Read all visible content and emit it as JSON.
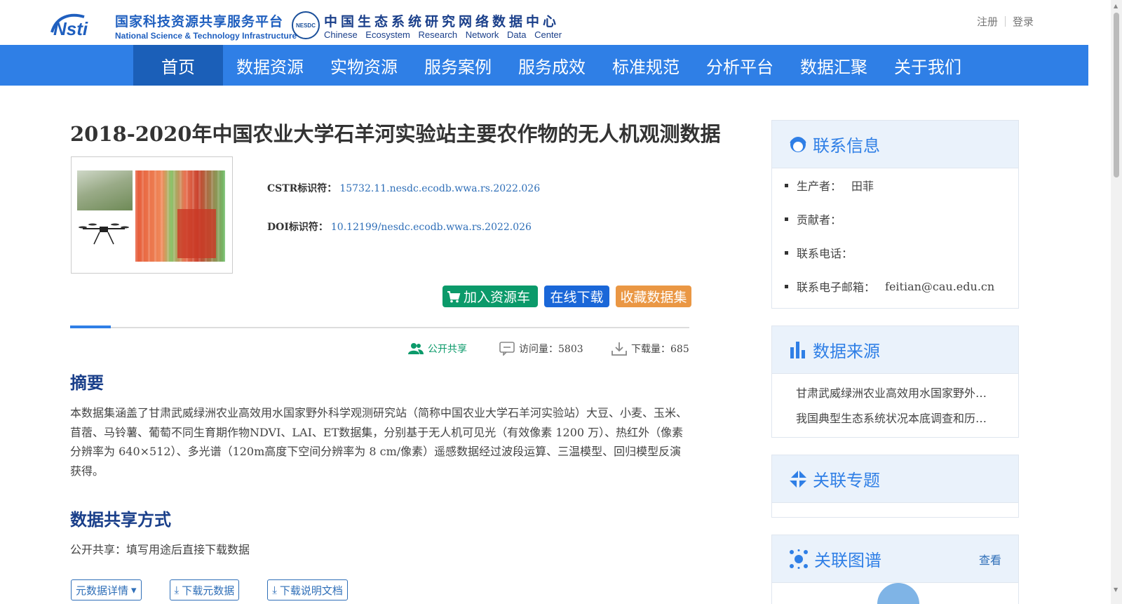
{
  "header": {
    "platform_logo_text": "Nsti",
    "platform_cn": "国家科技资源共享服务平台",
    "platform_en": "National Science & Technology Infrastructure",
    "nesdc_badge": "NESDC",
    "nesdc_cn": "中国生态系统研究网络数据中心",
    "nesdc_en": "Chinese Ecosystem Research Network Data Center",
    "register": "注册",
    "login": "登录"
  },
  "nav": {
    "items": [
      "首页",
      "数据资源",
      "实物资源",
      "服务案例",
      "服务成效",
      "标准规范",
      "分析平台",
      "数据汇聚",
      "关于我们"
    ],
    "active_index": 0,
    "color": "#2f7fe6"
  },
  "dataset": {
    "title": "2018-2020年中国农业大学石羊河实验站主要农作物的无人机观测数据",
    "cstr_label": "CSTR标识符：",
    "cstr_value": "15732.11.nesdc.ecodb.wwa.rs.2022.026",
    "doi_label": "DOI标识符：",
    "doi_value": "10.12199/nesdc.ecodb.wwa.rs.2022.026"
  },
  "actions": {
    "add_cart": "加入资源车",
    "download": "在线下载",
    "favorite": "收藏数据集"
  },
  "stats": {
    "share_mode": "公开共享",
    "visits": "访问量：5803",
    "downloads": "下载量：685"
  },
  "abstract": {
    "heading": "摘要",
    "text": "本数据集涵盖了甘肃武威绿洲农业高效用水国家野外科学观测研究站（简称中国农业大学石羊河实验站）大豆、小麦、玉米、苜蓿、马铃薯、葡萄不同生育期作物NDVI、LAI、ET数据集，分别基于无人机可见光（有效像素 1200 万）、热红外（像素分辨率为 640×512）、多光谱（120m高度下空间分辨率为 8 cm/像素）遥感数据经过波段运算、三温模型、回归模型反演获得。"
  },
  "sharing": {
    "heading": "数据共享方式",
    "text": "公开共享：填写用途后直接下载数据"
  },
  "bottom_buttons": {
    "metadata_detail": "元数据详情",
    "download_metadata": "下载元数据",
    "download_doc": "下载说明文档"
  },
  "sidebar": {
    "contact": {
      "title": "联系信息",
      "producer_label": "生产者：",
      "producer_value": "田菲",
      "contributor_label": "贡献者：",
      "phone_label": "联系电话：",
      "email_label": "联系电子邮箱：",
      "email_value": "feitian@cau.edu.cn"
    },
    "source": {
      "title": "数据来源",
      "items": [
        "甘肃武威绿洲农业高效用水国家野外…",
        "我国典型生态系统状况本底调查和历…"
      ]
    },
    "topic": {
      "title": "关联专题"
    },
    "graph": {
      "title": "关联图谱",
      "view_link": "查看"
    }
  }
}
